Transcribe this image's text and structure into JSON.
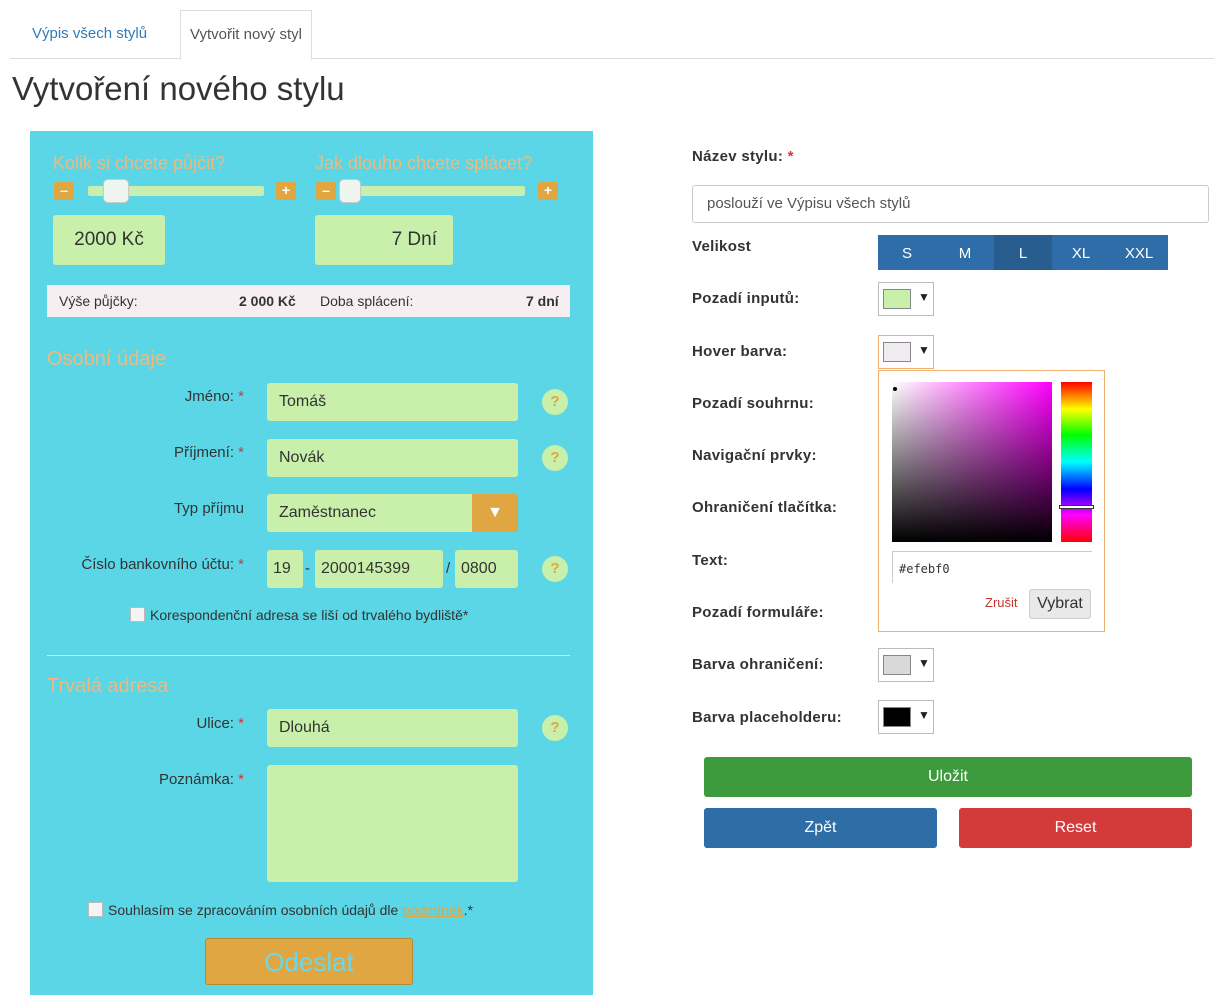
{
  "tabs": [
    "Výpis všech stylů",
    "Vytvořit nový styl"
  ],
  "page_title": "Vytvoření nového stylu",
  "preview": {
    "loan_amount_question": "Kolik si chcete půjčit?",
    "loan_term_question": "Jak dlouho chcete splácet?",
    "minus": "–",
    "plus": "+",
    "amount_value": "2000 Kč",
    "term_value": "7 Dní",
    "summary": {
      "amount_label": "Výše půjčky:",
      "amount_value": "2 000 Kč",
      "term_label": "Doba splácení:",
      "term_value": "7 dní"
    },
    "personal_section": "Osobní údaje",
    "first_name_label": "Jméno:",
    "first_name_value": "Tomáš",
    "last_name_label": "Příjmení:",
    "last_name_value": "Novák",
    "income_type_label": "Typ příjmu",
    "income_type_value": "Zaměstnanec",
    "dropdown_arrow": "▼",
    "account_label": "Číslo bankovního účtu:",
    "account_prefix": "19",
    "account_dash": "-",
    "account_number": "2000145399",
    "account_slash": "/",
    "account_bank": "0800",
    "required_mark": "*",
    "help": "?",
    "correspondence_label": "Korespondenční adresa se liší od trvalého bydliště*",
    "address_section": "Trvalá adresa",
    "street_label": "Ulice:",
    "street_value": "Dlouhá",
    "note_label": "Poznámka:",
    "consent_text": "Souhlasím se zpracováním osobních údajů dle",
    "consent_link": "podmínek",
    "consent_suffix": ".*",
    "submit": "Odeslat"
  },
  "settings": {
    "style_name_label": "Název stylu:",
    "required_mark": "*",
    "style_name_placeholder": "poslouží ve Výpisu všech stylů",
    "size_label": "Velikost",
    "sizes": [
      "S",
      "M",
      "L",
      "XL",
      "XXL"
    ],
    "active_size": "L",
    "input_bg_label": "Pozadí inputů:",
    "hover_label": "Hover barva:",
    "summary_bg_label": "Pozadí souhrnu:",
    "nav_label": "Navigační prvky:",
    "button_border_label": "Ohraničení tlačítka:",
    "text_label": "Text:",
    "form_bg_label": "Pozadí formuláře:",
    "border_color_label": "Barva ohraničení:",
    "placeholder_color_label": "Barva placeholderu:",
    "arrow": "▼",
    "picker": {
      "hex_value": "#efebf0",
      "cancel": "Zrušit",
      "choose": "Vybrat"
    },
    "save": "Uložit",
    "back": "Zpět",
    "reset": "Reset"
  },
  "colors": {
    "input_bg": "#c8f0aa",
    "hover": "#efebf0",
    "border": "#d9d9d9",
    "placeholder": "#000000",
    "form_bg": "#5ad6e6",
    "accent": "#e0a642"
  }
}
